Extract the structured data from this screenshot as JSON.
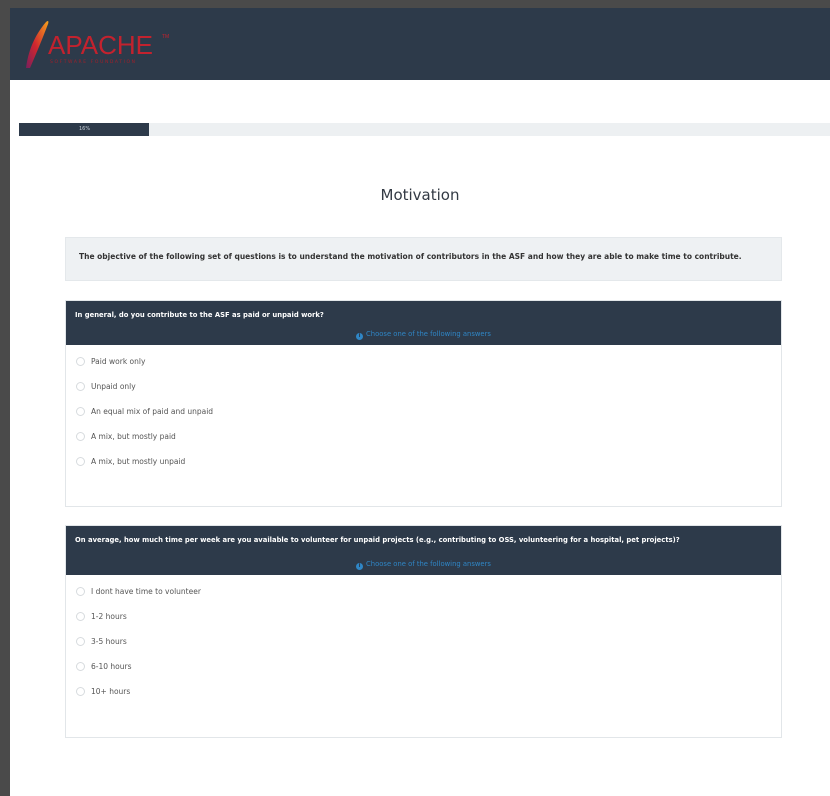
{
  "header": {
    "logo_text": "APACHE",
    "logo_subtext": "SOFTWARE FOUNDATION",
    "logo_tm": "TM",
    "colors": {
      "bar": "#2d3a4a",
      "logo": "#c3222e"
    }
  },
  "progress": {
    "percent": 16,
    "label": "16%"
  },
  "group": {
    "title": "Motivation",
    "description": "The objective of the following set of questions is to understand the motivation of contributors in the ASF and how they are able to make time to contribute."
  },
  "questions": [
    {
      "text": "In general, do you contribute to the ASF as paid or unpaid work?",
      "help": "Choose one of the following answers",
      "answers": [
        "Paid work only",
        "Unpaid only",
        "An equal mix of paid and unpaid",
        "A mix, but mostly paid",
        "A mix, but mostly unpaid"
      ]
    },
    {
      "text": "On average, how much time per week are you available to volunteer for unpaid projects (e.g., contributing to OSS, volunteering for a hospital, pet projects)?",
      "help": "Choose one of the following answers",
      "answers": [
        "I dont have time to volunteer",
        "1-2 hours",
        "3-5 hours",
        "6-10 hours",
        "10+ hours"
      ]
    }
  ],
  "icons": {
    "info": "info-circle-icon",
    "logo": "apache-feather-icon"
  }
}
